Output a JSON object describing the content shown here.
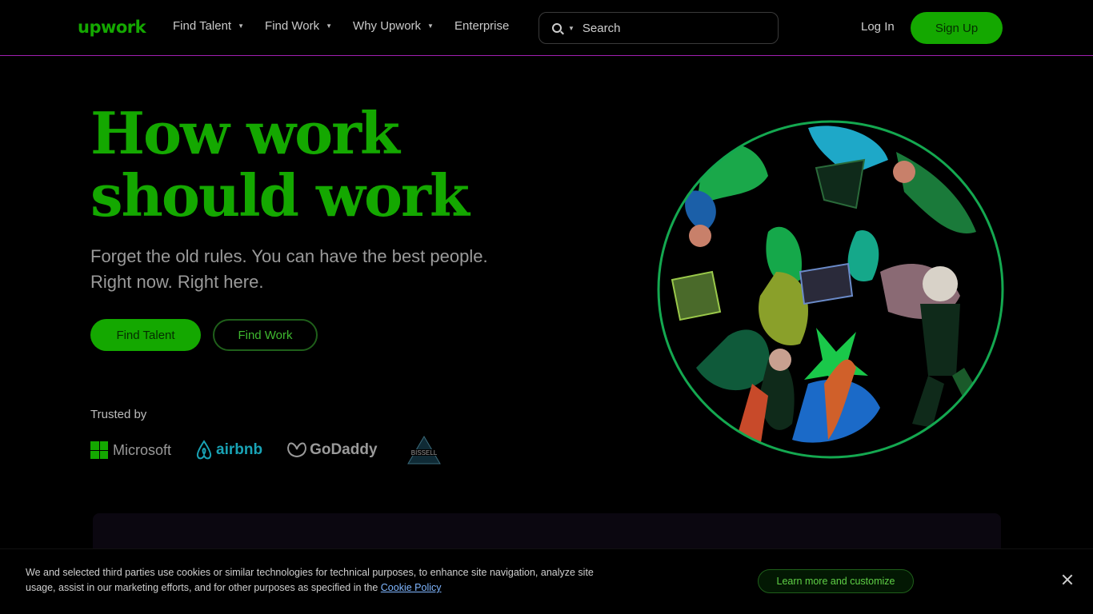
{
  "header": {
    "logo": "upwork",
    "nav": [
      {
        "label": "Find Talent",
        "has_dropdown": true
      },
      {
        "label": "Find Work",
        "has_dropdown": true
      },
      {
        "label": "Why Upwork",
        "has_dropdown": true
      },
      {
        "label": "Enterprise",
        "has_dropdown": false
      }
    ],
    "search": {
      "placeholder": "Search",
      "value": ""
    },
    "login_label": "Log In",
    "signup_label": "Sign Up"
  },
  "hero": {
    "title_line1": "How work",
    "title_line2": "should work",
    "subtitle_line1": "Forget the old rules. You can have the best people.",
    "subtitle_line2": "Right now. Right here.",
    "cta_primary": "Find Talent",
    "cta_secondary": "Find Work",
    "trusted_label": "Trusted by",
    "logos": {
      "microsoft": "Microsoft",
      "airbnb": "airbnb",
      "godaddy": "GoDaddy",
      "bissell": "BISSELL"
    }
  },
  "cookie": {
    "text_line1": "We and selected third parties use cookies or similar technologies for technical purposes, to enhance site navigation, analyze site",
    "text_line2": "usage, assist in our marketing efforts, and for other purposes as specified in the",
    "link_label": "Cookie Policy",
    "button_label": "Learn more and customize"
  },
  "colors": {
    "brand_green": "#14a800",
    "header_border": "#a01fb0",
    "background": "#000000"
  }
}
